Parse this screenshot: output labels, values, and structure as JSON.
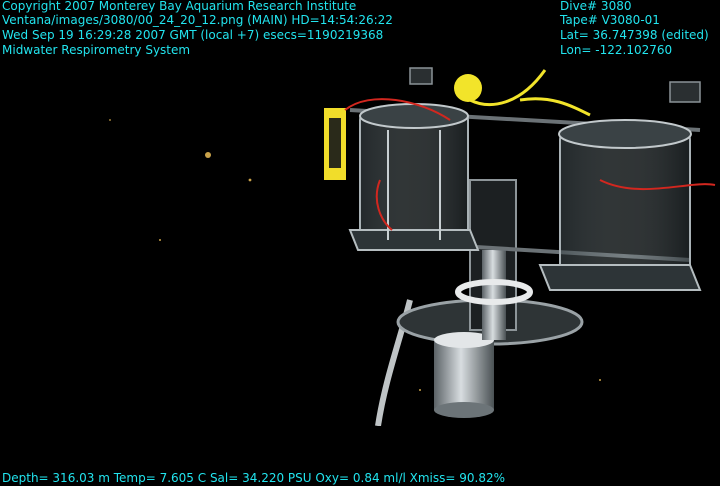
{
  "overlay": {
    "line1": "Copyright 2007 Monterey Bay Aquarium Research Institute",
    "line2": "Ventana/images/3080/00_24_20_12.png (MAIN)  HD=14:54:26:22",
    "line3": "Wed Sep 19 16:29:28 2007 GMT (local +7)  esecs=1190219368",
    "line4": "Midwater Respirometry System",
    "dive": "Dive# 3080",
    "tape": "Tape# V3080-01",
    "lat": "Lat= 36.747398 (edited)",
    "lon": "Lon= -122.102760",
    "sensors": "Depth= 316.03 m  Temp= 7.605 C  Sal= 34.220 PSU  Oxy= 0.84 ml/l  Xmiss= 90.82%"
  },
  "colors": {
    "overlay_text": "#22e4ee",
    "background": "#000000",
    "float": "#f2e42a"
  }
}
